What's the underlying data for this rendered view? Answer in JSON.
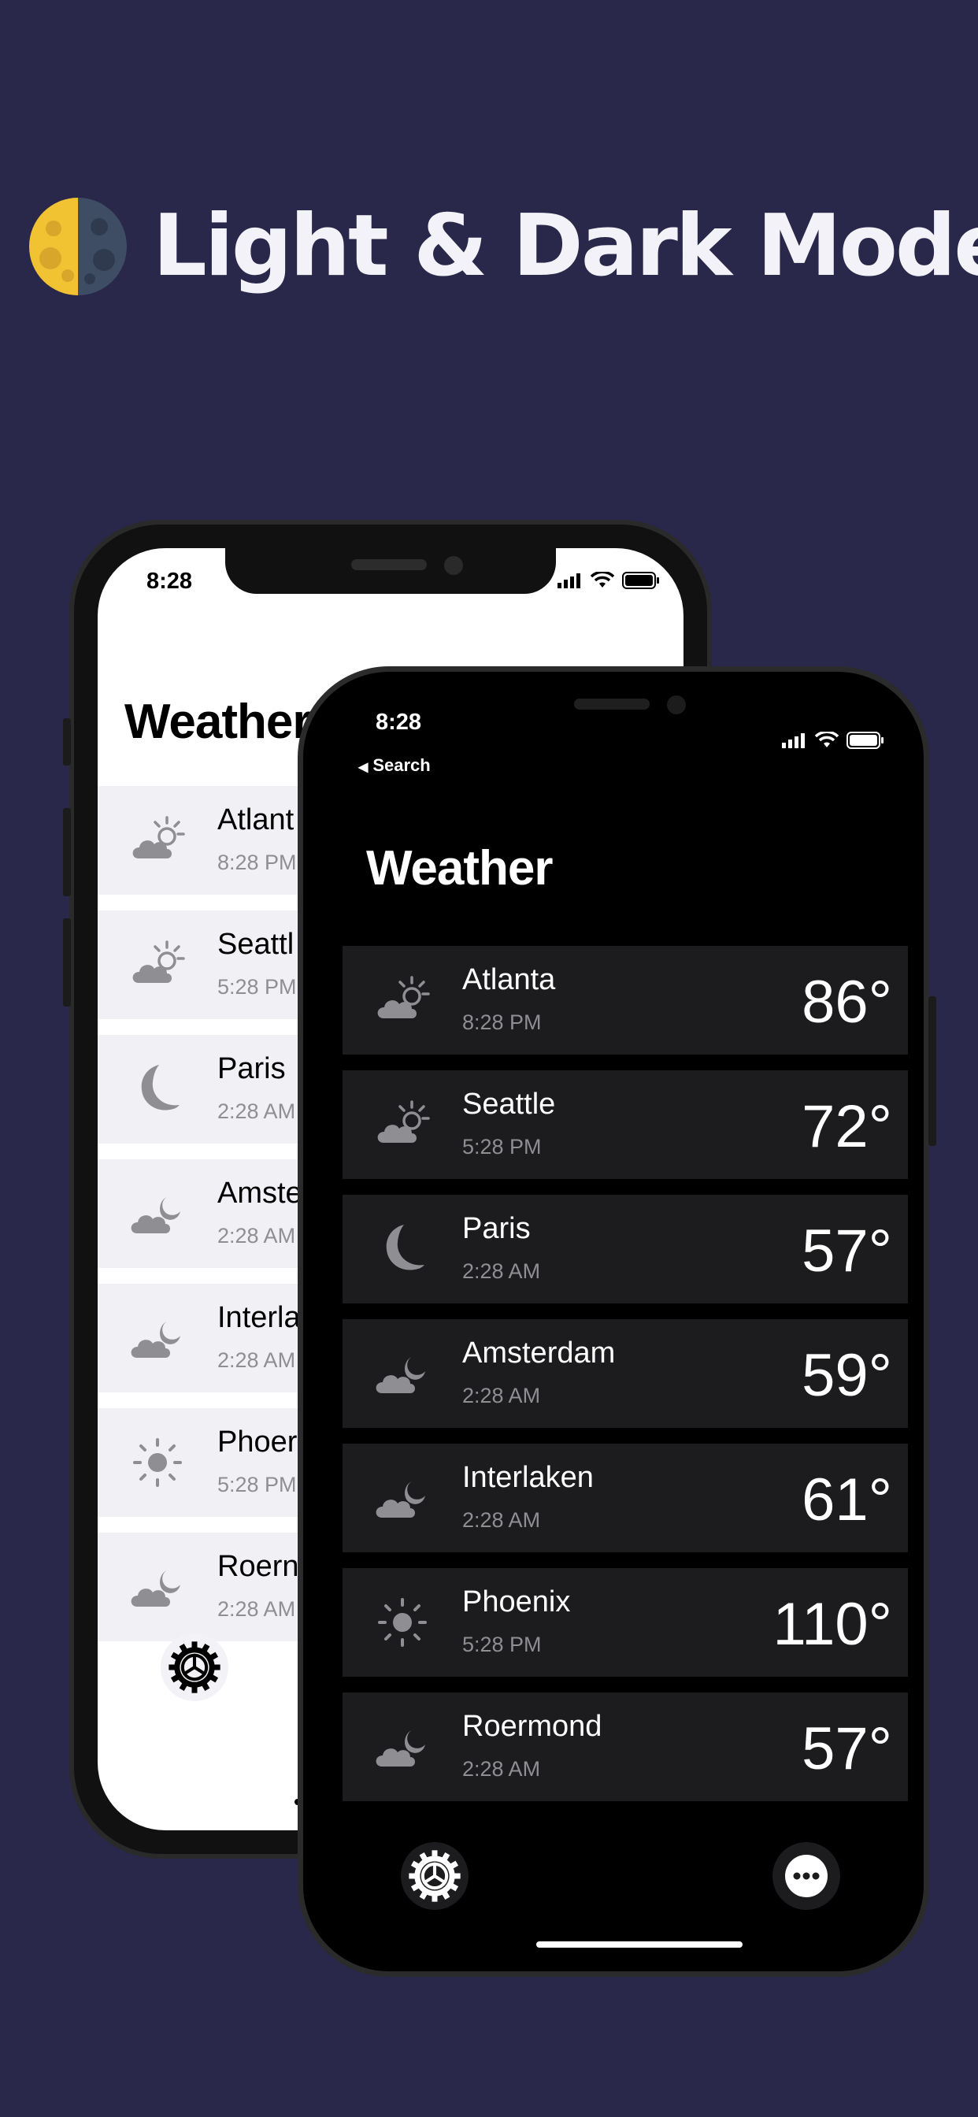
{
  "headline": "Light & Dark Mode",
  "icons": {
    "moon": "moon-quarter-icon",
    "sun_cloud": "cloud-sun-icon",
    "moon_crescent": "moon-icon",
    "moon_cloud": "cloud-moon-icon",
    "sun": "sun-icon",
    "settings": "gear-icon",
    "more": "ellipsis-icon"
  },
  "light_phone": {
    "status_time": "8:28",
    "title": "Weather",
    "rows": [
      {
        "city": "Atlant",
        "time": "8:28 PM",
        "icon": "cloud-sun-icon"
      },
      {
        "city": "Seattl",
        "time": "5:28 PM",
        "icon": "cloud-sun-icon"
      },
      {
        "city": "Paris",
        "time": "2:28 AM",
        "icon": "moon-icon"
      },
      {
        "city": "Amste",
        "time": "2:28 AM",
        "icon": "cloud-moon-icon"
      },
      {
        "city": "Interla",
        "time": "2:28 AM",
        "icon": "cloud-moon-icon"
      },
      {
        "city": "Phoer",
        "time": "5:28 PM",
        "icon": "sun-icon"
      },
      {
        "city": "Roern",
        "time": "2:28 AM",
        "icon": "cloud-moon-icon"
      }
    ]
  },
  "dark_phone": {
    "status_time": "8:28",
    "back_label": "Search",
    "title": "Weather",
    "rows": [
      {
        "city": "Atlanta",
        "time": "8:28 PM",
        "temp": "86°",
        "icon": "cloud-sun-icon"
      },
      {
        "city": "Seattle",
        "time": "5:28 PM",
        "temp": "72°",
        "icon": "cloud-sun-icon"
      },
      {
        "city": "Paris",
        "time": "2:28 AM",
        "temp": "57°",
        "icon": "moon-icon"
      },
      {
        "city": "Amsterdam",
        "time": "2:28 AM",
        "temp": "59°",
        "icon": "cloud-moon-icon"
      },
      {
        "city": "Interlaken",
        "time": "2:28 AM",
        "temp": "61°",
        "icon": "cloud-moon-icon"
      },
      {
        "city": "Phoenix",
        "time": "5:28 PM",
        "temp": "110°",
        "icon": "sun-icon"
      },
      {
        "city": "Roermond",
        "time": "2:28 AM",
        "temp": "57°",
        "icon": "cloud-moon-icon"
      }
    ]
  },
  "colors": {
    "background": "#29284a",
    "row_light": "#f0f0f5",
    "row_dark": "#1c1c1e",
    "icon_gray": "#8e8e93"
  }
}
